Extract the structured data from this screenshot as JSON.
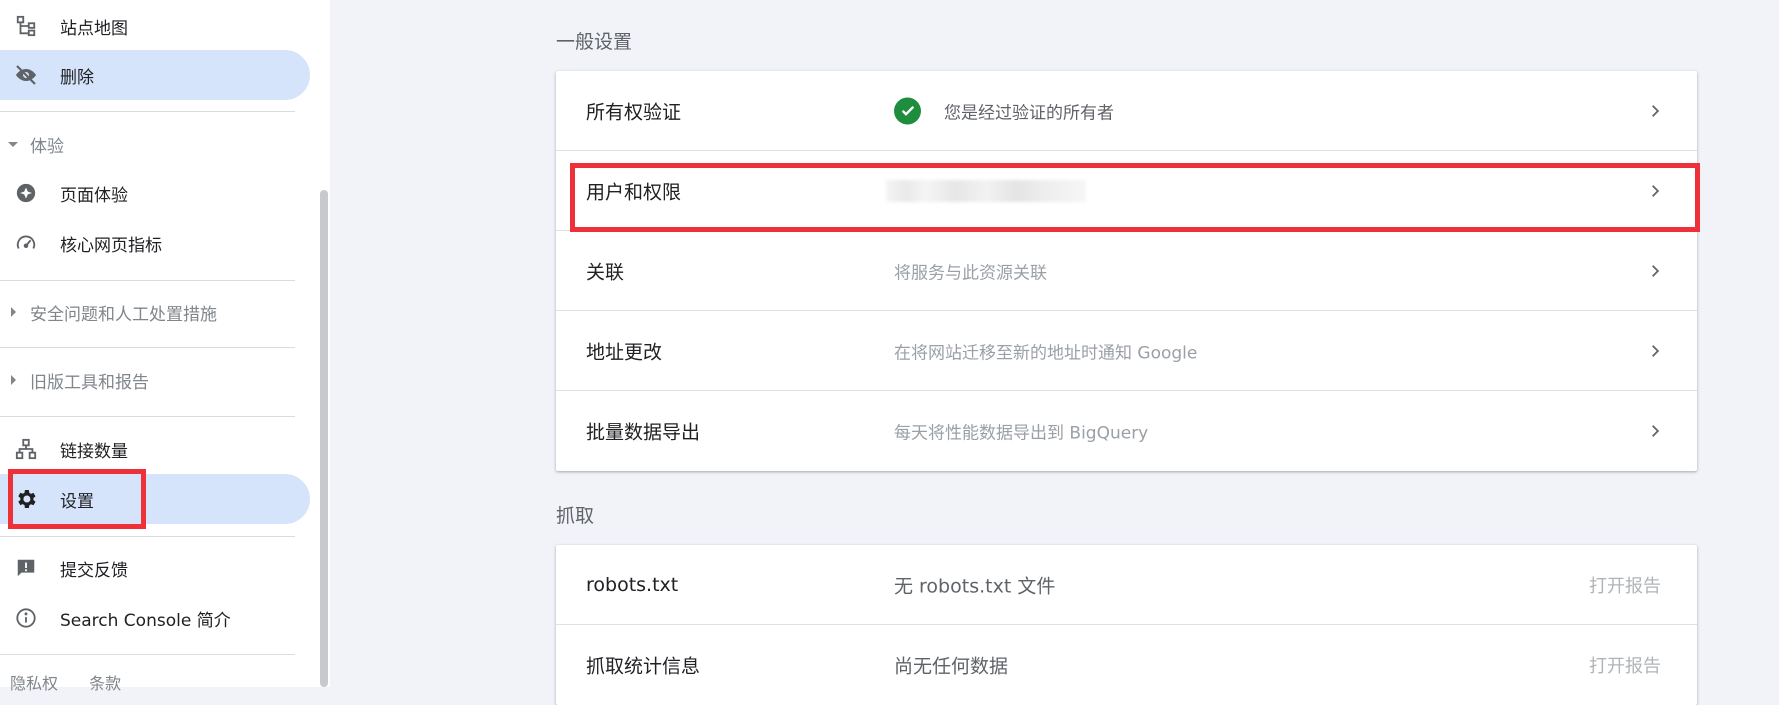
{
  "sidebar": {
    "items": [
      {
        "label": "站点地图",
        "icon": "sitemap-icon"
      },
      {
        "label": "删除",
        "icon": "eye-off-icon",
        "active": true
      },
      {
        "label": "页面体验",
        "icon": "page-experience-icon"
      },
      {
        "label": "核心网页指标",
        "icon": "speedometer-icon"
      },
      {
        "label": "链接数量",
        "icon": "links-icon"
      },
      {
        "label": "设置",
        "icon": "gear-icon",
        "active": true
      },
      {
        "label": "提交反馈",
        "icon": "feedback-icon"
      },
      {
        "label": "Search Console 简介",
        "icon": "info-icon"
      }
    ],
    "sections": {
      "experience": "体验",
      "security": "安全问题和人工处置措施",
      "legacy": "旧版工具和报告"
    },
    "footer": {
      "privacy": "隐私权",
      "terms": "条款"
    }
  },
  "main": {
    "general": {
      "title": "一般设置",
      "rows": [
        {
          "label": "所有权验证",
          "value": "您是经过验证的所有者"
        },
        {
          "label": "用户和权限",
          "value": ""
        },
        {
          "label": "关联",
          "value": "将服务与此资源关联"
        },
        {
          "label": "地址更改",
          "value": "在将网站迁移至新的地址时通知 Google"
        },
        {
          "label": "批量数据导出",
          "value": "每天将性能数据导出到 BigQuery"
        }
      ]
    },
    "crawl": {
      "title": "抓取",
      "rows": [
        {
          "label": "robots.txt",
          "value": "无 robots.txt 文件",
          "action": "打开报告"
        },
        {
          "label": "抓取统计信息",
          "value": "尚无任何数据",
          "action": "打开报告"
        }
      ]
    }
  },
  "colors": {
    "active_bg": "#d6e4fb",
    "highlight_red": "#ee3138",
    "verified_green": "#1e8e3e"
  }
}
